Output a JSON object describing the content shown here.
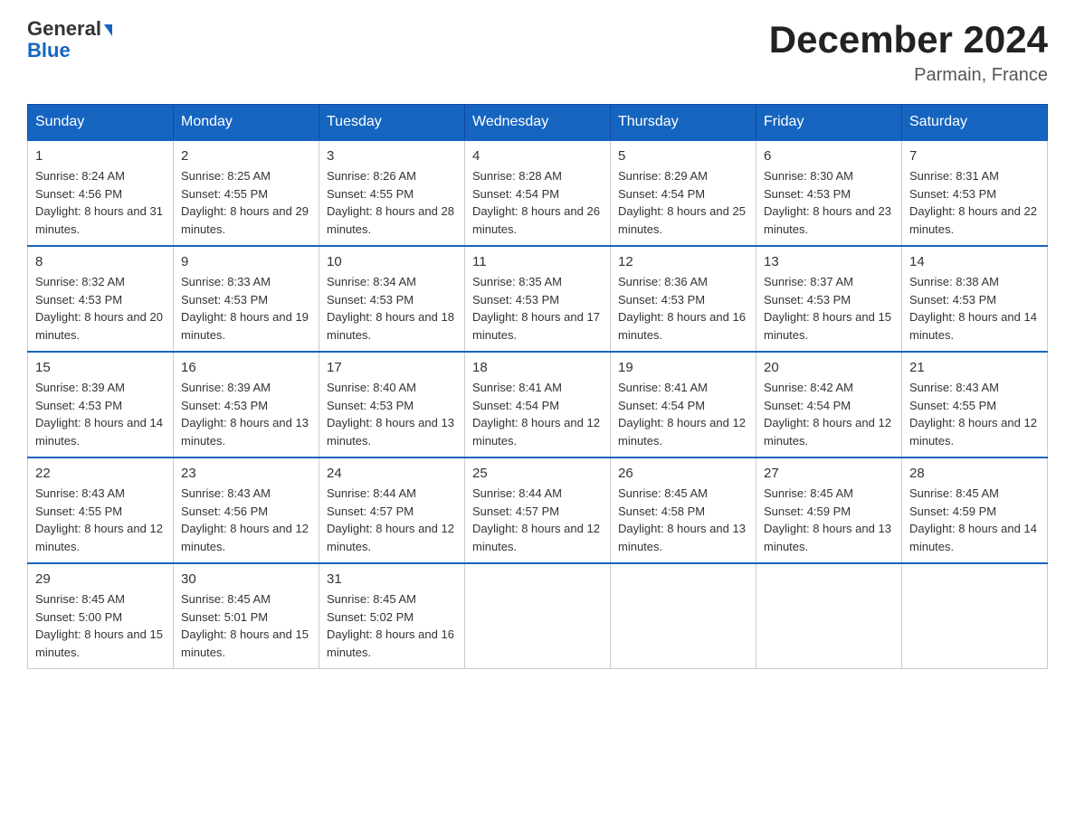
{
  "logo": {
    "general": "General",
    "blue": "Blue",
    "arrow": "▶"
  },
  "title": "December 2024",
  "subtitle": "Parmain, France",
  "columns": [
    "Sunday",
    "Monday",
    "Tuesday",
    "Wednesday",
    "Thursday",
    "Friday",
    "Saturday"
  ],
  "weeks": [
    [
      {
        "day": "1",
        "sunrise": "8:24 AM",
        "sunset": "4:56 PM",
        "daylight": "8 hours and 31 minutes."
      },
      {
        "day": "2",
        "sunrise": "8:25 AM",
        "sunset": "4:55 PM",
        "daylight": "8 hours and 29 minutes."
      },
      {
        "day": "3",
        "sunrise": "8:26 AM",
        "sunset": "4:55 PM",
        "daylight": "8 hours and 28 minutes."
      },
      {
        "day": "4",
        "sunrise": "8:28 AM",
        "sunset": "4:54 PM",
        "daylight": "8 hours and 26 minutes."
      },
      {
        "day": "5",
        "sunrise": "8:29 AM",
        "sunset": "4:54 PM",
        "daylight": "8 hours and 25 minutes."
      },
      {
        "day": "6",
        "sunrise": "8:30 AM",
        "sunset": "4:53 PM",
        "daylight": "8 hours and 23 minutes."
      },
      {
        "day": "7",
        "sunrise": "8:31 AM",
        "sunset": "4:53 PM",
        "daylight": "8 hours and 22 minutes."
      }
    ],
    [
      {
        "day": "8",
        "sunrise": "8:32 AM",
        "sunset": "4:53 PM",
        "daylight": "8 hours and 20 minutes."
      },
      {
        "day": "9",
        "sunrise": "8:33 AM",
        "sunset": "4:53 PM",
        "daylight": "8 hours and 19 minutes."
      },
      {
        "day": "10",
        "sunrise": "8:34 AM",
        "sunset": "4:53 PM",
        "daylight": "8 hours and 18 minutes."
      },
      {
        "day": "11",
        "sunrise": "8:35 AM",
        "sunset": "4:53 PM",
        "daylight": "8 hours and 17 minutes."
      },
      {
        "day": "12",
        "sunrise": "8:36 AM",
        "sunset": "4:53 PM",
        "daylight": "8 hours and 16 minutes."
      },
      {
        "day": "13",
        "sunrise": "8:37 AM",
        "sunset": "4:53 PM",
        "daylight": "8 hours and 15 minutes."
      },
      {
        "day": "14",
        "sunrise": "8:38 AM",
        "sunset": "4:53 PM",
        "daylight": "8 hours and 14 minutes."
      }
    ],
    [
      {
        "day": "15",
        "sunrise": "8:39 AM",
        "sunset": "4:53 PM",
        "daylight": "8 hours and 14 minutes."
      },
      {
        "day": "16",
        "sunrise": "8:39 AM",
        "sunset": "4:53 PM",
        "daylight": "8 hours and 13 minutes."
      },
      {
        "day": "17",
        "sunrise": "8:40 AM",
        "sunset": "4:53 PM",
        "daylight": "8 hours and 13 minutes."
      },
      {
        "day": "18",
        "sunrise": "8:41 AM",
        "sunset": "4:54 PM",
        "daylight": "8 hours and 12 minutes."
      },
      {
        "day": "19",
        "sunrise": "8:41 AM",
        "sunset": "4:54 PM",
        "daylight": "8 hours and 12 minutes."
      },
      {
        "day": "20",
        "sunrise": "8:42 AM",
        "sunset": "4:54 PM",
        "daylight": "8 hours and 12 minutes."
      },
      {
        "day": "21",
        "sunrise": "8:43 AM",
        "sunset": "4:55 PM",
        "daylight": "8 hours and 12 minutes."
      }
    ],
    [
      {
        "day": "22",
        "sunrise": "8:43 AM",
        "sunset": "4:55 PM",
        "daylight": "8 hours and 12 minutes."
      },
      {
        "day": "23",
        "sunrise": "8:43 AM",
        "sunset": "4:56 PM",
        "daylight": "8 hours and 12 minutes."
      },
      {
        "day": "24",
        "sunrise": "8:44 AM",
        "sunset": "4:57 PM",
        "daylight": "8 hours and 12 minutes."
      },
      {
        "day": "25",
        "sunrise": "8:44 AM",
        "sunset": "4:57 PM",
        "daylight": "8 hours and 12 minutes."
      },
      {
        "day": "26",
        "sunrise": "8:45 AM",
        "sunset": "4:58 PM",
        "daylight": "8 hours and 13 minutes."
      },
      {
        "day": "27",
        "sunrise": "8:45 AM",
        "sunset": "4:59 PM",
        "daylight": "8 hours and 13 minutes."
      },
      {
        "day": "28",
        "sunrise": "8:45 AM",
        "sunset": "4:59 PM",
        "daylight": "8 hours and 14 minutes."
      }
    ],
    [
      {
        "day": "29",
        "sunrise": "8:45 AM",
        "sunset": "5:00 PM",
        "daylight": "8 hours and 15 minutes."
      },
      {
        "day": "30",
        "sunrise": "8:45 AM",
        "sunset": "5:01 PM",
        "daylight": "8 hours and 15 minutes."
      },
      {
        "day": "31",
        "sunrise": "8:45 AM",
        "sunset": "5:02 PM",
        "daylight": "8 hours and 16 minutes."
      },
      null,
      null,
      null,
      null
    ]
  ]
}
